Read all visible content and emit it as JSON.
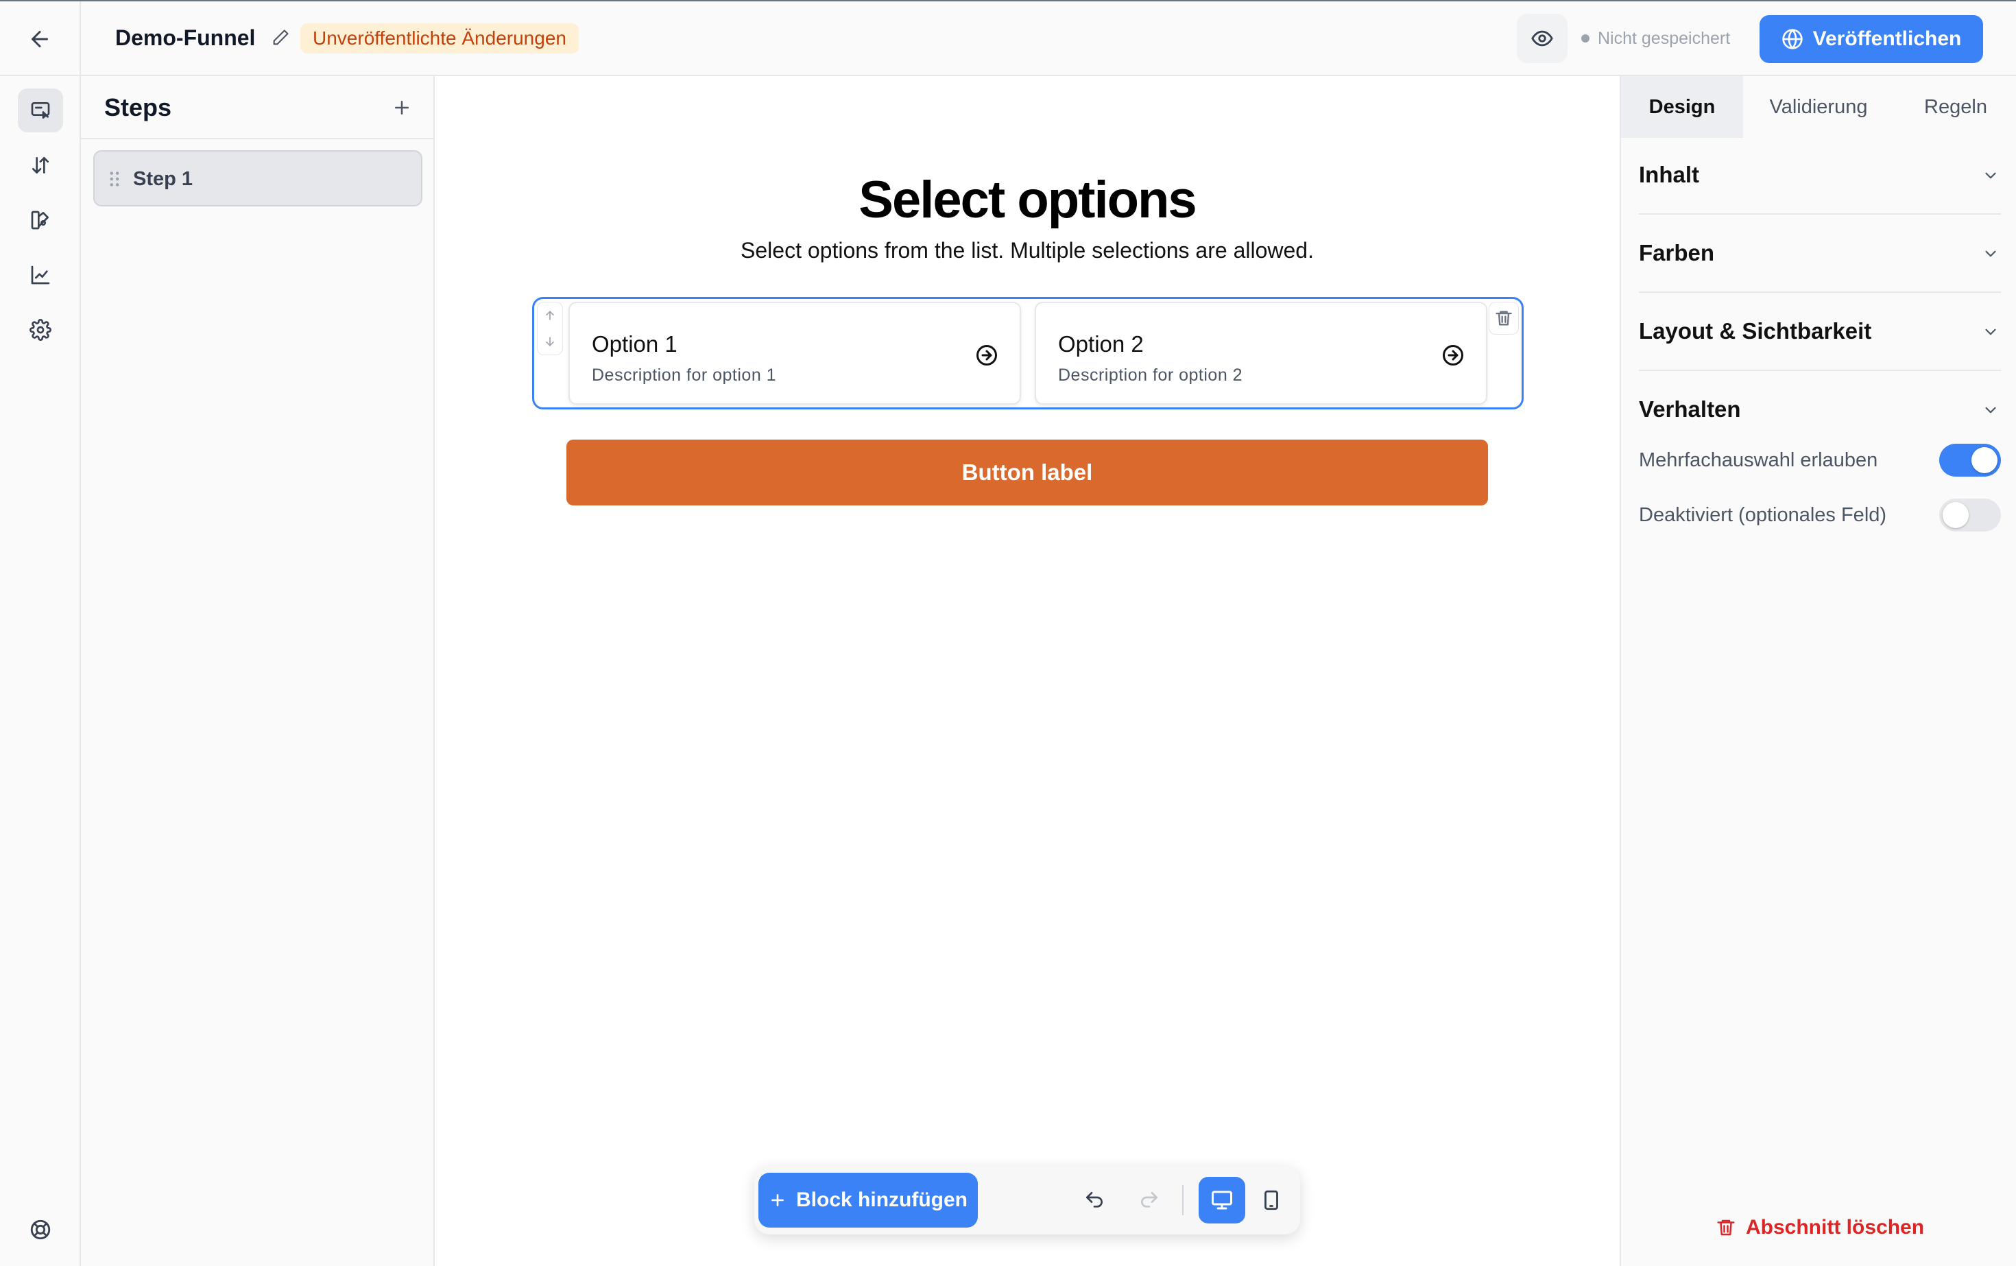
{
  "header": {
    "title": "Demo-Funnel",
    "badge": "Unveröffentlichte Änderungen",
    "save_status": "Nicht gespeichert",
    "publish_label": "Veröffentlichen"
  },
  "rail": {
    "items": [
      "editor-icon",
      "sort-icon",
      "theme-icon",
      "chart-icon",
      "gear-icon"
    ],
    "help_icon": "lifebuoy-icon"
  },
  "steps_panel": {
    "title": "Steps",
    "items": [
      {
        "label": "Step 1",
        "active": true
      }
    ]
  },
  "canvas": {
    "heading": "Select options",
    "subheading": "Select options from the list. Multiple selections are allowed.",
    "options": [
      {
        "title": "Option 1",
        "description": "Description for option 1"
      },
      {
        "title": "Option 2",
        "description": "Description for option 2"
      }
    ],
    "button_label": "Button label",
    "button_color": "#d9692c"
  },
  "toolbar": {
    "add_block_label": "Block hinzufügen",
    "device": "desktop"
  },
  "right_panel": {
    "tabs": [
      {
        "label": "Design",
        "active": true
      },
      {
        "label": "Validierung",
        "active": false
      },
      {
        "label": "Regeln",
        "active": false
      }
    ],
    "sections": [
      "Inhalt",
      "Farben",
      "Layout & Sichtbarkeit",
      "Verhalten"
    ],
    "behavior": {
      "multi_select_label": "Mehrfachauswahl erlauben",
      "multi_select_on": true,
      "disabled_label": "Deaktiviert (optionales Feld)",
      "disabled_on": false
    },
    "delete_label": "Abschnitt löschen"
  },
  "colors": {
    "accent": "#3b82f6",
    "warning_badge_bg": "#fdf0d5",
    "warning_badge_text": "#c2410c",
    "danger": "#dc2626"
  }
}
